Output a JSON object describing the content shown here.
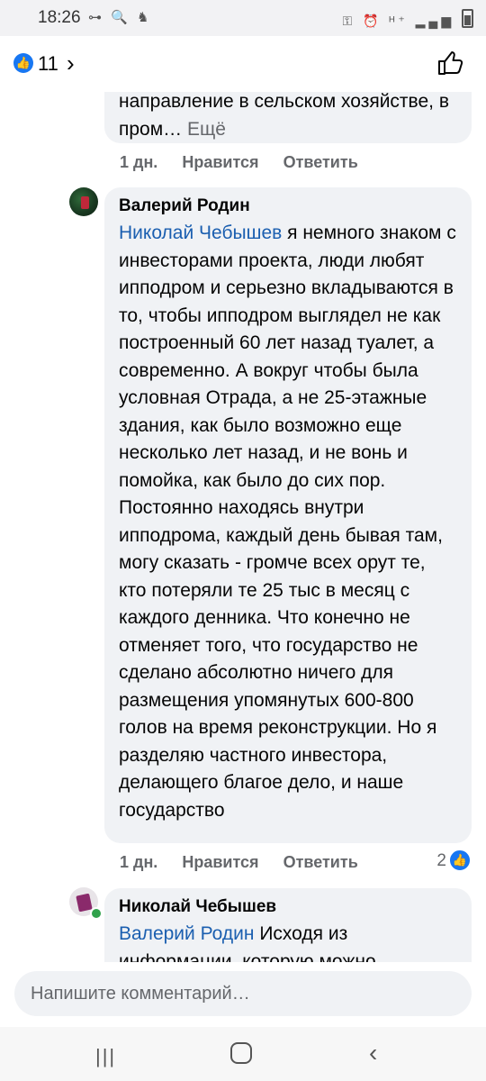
{
  "status_bar": {
    "time": "18:26",
    "left_icons": "⊶ 🔍 ♞",
    "right_icons": "⚿ ⏰ ᴴ⁺ ▂▄▆"
  },
  "header": {
    "like_count": "11",
    "accent": "#1877f2"
  },
  "comments": [
    {
      "text_tail": "направление в сельском хозяйстве, в пром…",
      "more": "Ещё",
      "time": "1 дн.",
      "like_label": "Нравится",
      "reply_label": "Ответить"
    },
    {
      "author": "Валерий Родин",
      "mention": "Николай Чебышев",
      "text": "я немного знаком с инвесторами проекта, люди любят ипподром и серьезно вкладываются в то, чтобы ипподром выглядел не как построенный 60 лет назад туалет, а современно. А вокруг чтобы была условная Отрада, а не 25-этажные здания, как было возможно еще несколько лет назад, и не вонь и помойка, как было до сих пор. Постоянно находясь внутри ипподрома, каждый день бывая там, могу сказать - громче всех орут те, кто потеряли те 25 тыс в месяц с каждого денника. Что конечно не отменяет того, что государство не сделано абсолютно ничего для размещения упомянутых 600-800 голов на время реконструкции. Но я разделяю частного инвестора, делающего благое дело, и наше государство",
      "time": "1 дн.",
      "like_label": "Нравится",
      "reply_label": "Ответить",
      "reactions": "2"
    },
    {
      "author": "Николай Чебышев",
      "mention": "Валерий Родин",
      "text": "Исходя из информации, которую можно"
    }
  ],
  "composer": {
    "placeholder": "Напишите комментарий…"
  },
  "nav": {
    "recent": "|||",
    "back": "‹"
  }
}
